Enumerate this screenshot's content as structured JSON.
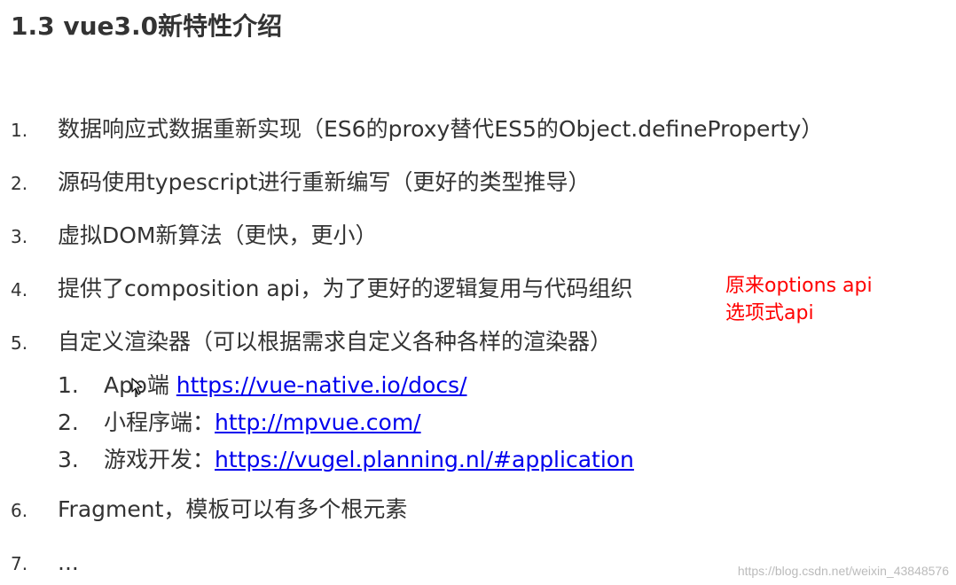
{
  "title": "1.3 vue3.0新特性介绍",
  "items": [
    {
      "num": "1.",
      "text": "数据响应式数据重新实现（ES6的proxy替代ES5的Object.defineProperty）"
    },
    {
      "num": "2.",
      "text": "源码使用typescript进行重新编写（更好的类型推导）"
    },
    {
      "num": "3.",
      "text": "虚拟DOM新算法（更快，更小）"
    },
    {
      "num": "4.",
      "text": "提供了composition api，为了更好的逻辑复用与代码组织"
    },
    {
      "num": "5.",
      "text": "自定义渲染器（可以根据需求自定义各种各样的渲染器）"
    },
    {
      "num": "6.",
      "text": "Fragment，模板可以有多个根元素"
    },
    {
      "num": "7.",
      "text": "..."
    }
  ],
  "subitems": [
    {
      "num": "1.",
      "label": "App端 ",
      "link": "https://vue-native.io/docs/"
    },
    {
      "num": "2.",
      "label": "小程序端：",
      "link": "http://mpvue.com/"
    },
    {
      "num": "3.",
      "label": "游戏开发：",
      "link": "https://vugel.planning.nl/#application"
    }
  ],
  "note": {
    "line1": "原来options api",
    "line2": "选项式api"
  },
  "watermark": "https://blog.csdn.net/weixin_43848576",
  "colors": {
    "text": "#333333",
    "link": "#0000ee",
    "note": "#ff0000"
  }
}
